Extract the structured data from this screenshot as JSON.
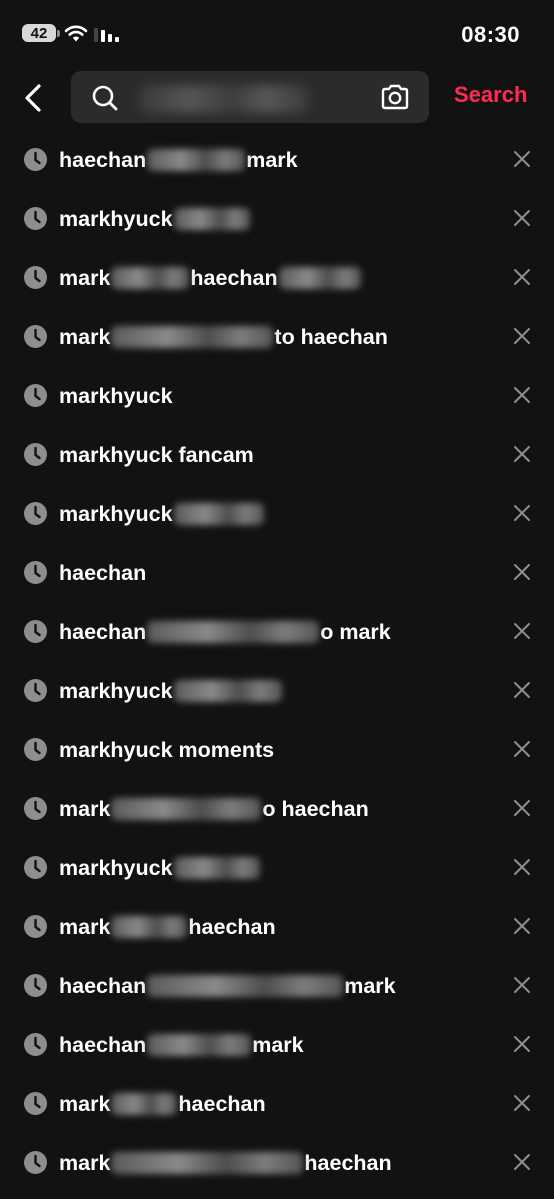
{
  "status_bar": {
    "battery": "42",
    "time": "08:30"
  },
  "search": {
    "button_label": "Search",
    "query": ""
  },
  "colors": {
    "accent": "#fe2c55",
    "background": "#121212",
    "search_field": "#2b2b2b",
    "icon_gray": "#8e8e8e"
  },
  "icons": {
    "back": "chevron-left-icon",
    "search": "search-icon",
    "camera": "camera-icon",
    "history": "clock-icon",
    "remove": "close-icon"
  },
  "history": [
    {
      "parts": [
        {
          "t": "haechan"
        },
        {
          "b": 98
        },
        {
          "t": "mark"
        }
      ]
    },
    {
      "parts": [
        {
          "t": "markhyuck"
        },
        {
          "b": 76
        }
      ]
    },
    {
      "parts": [
        {
          "t": "mark"
        },
        {
          "b": 78
        },
        {
          "t": "haechan"
        },
        {
          "b": 82
        }
      ]
    },
    {
      "parts": [
        {
          "t": "mark"
        },
        {
          "b": 162
        },
        {
          "t": "to haechan"
        }
      ]
    },
    {
      "parts": [
        {
          "t": "markhyuck"
        }
      ]
    },
    {
      "parts": [
        {
          "t": "markhyuck fancam"
        }
      ]
    },
    {
      "parts": [
        {
          "t": "markhyuck"
        },
        {
          "b": 90
        }
      ]
    },
    {
      "parts": [
        {
          "t": "haechan"
        }
      ]
    },
    {
      "parts": [
        {
          "t": "haechan"
        },
        {
          "b": 172
        },
        {
          "t": "o mark"
        }
      ]
    },
    {
      "parts": [
        {
          "t": "markhyuck"
        },
        {
          "b": 108
        }
      ]
    },
    {
      "parts": [
        {
          "t": "markhyuck moments"
        }
      ]
    },
    {
      "parts": [
        {
          "t": "mark"
        },
        {
          "b": 150
        },
        {
          "t": "o haechan"
        }
      ]
    },
    {
      "parts": [
        {
          "t": "markhyuck"
        },
        {
          "b": 86
        }
      ]
    },
    {
      "parts": [
        {
          "t": "mark"
        },
        {
          "b": 76
        },
        {
          "t": "haechan"
        }
      ]
    },
    {
      "parts": [
        {
          "t": "haechan"
        },
        {
          "b": 196
        },
        {
          "t": "mark"
        }
      ]
    },
    {
      "parts": [
        {
          "t": "haechan"
        },
        {
          "b": 104
        },
        {
          "t": "mark"
        }
      ]
    },
    {
      "parts": [
        {
          "t": "mark"
        },
        {
          "b": 66
        },
        {
          "t": "haechan"
        }
      ]
    },
    {
      "parts": [
        {
          "t": "mark"
        },
        {
          "b": 192
        },
        {
          "t": "haechan"
        }
      ]
    }
  ]
}
